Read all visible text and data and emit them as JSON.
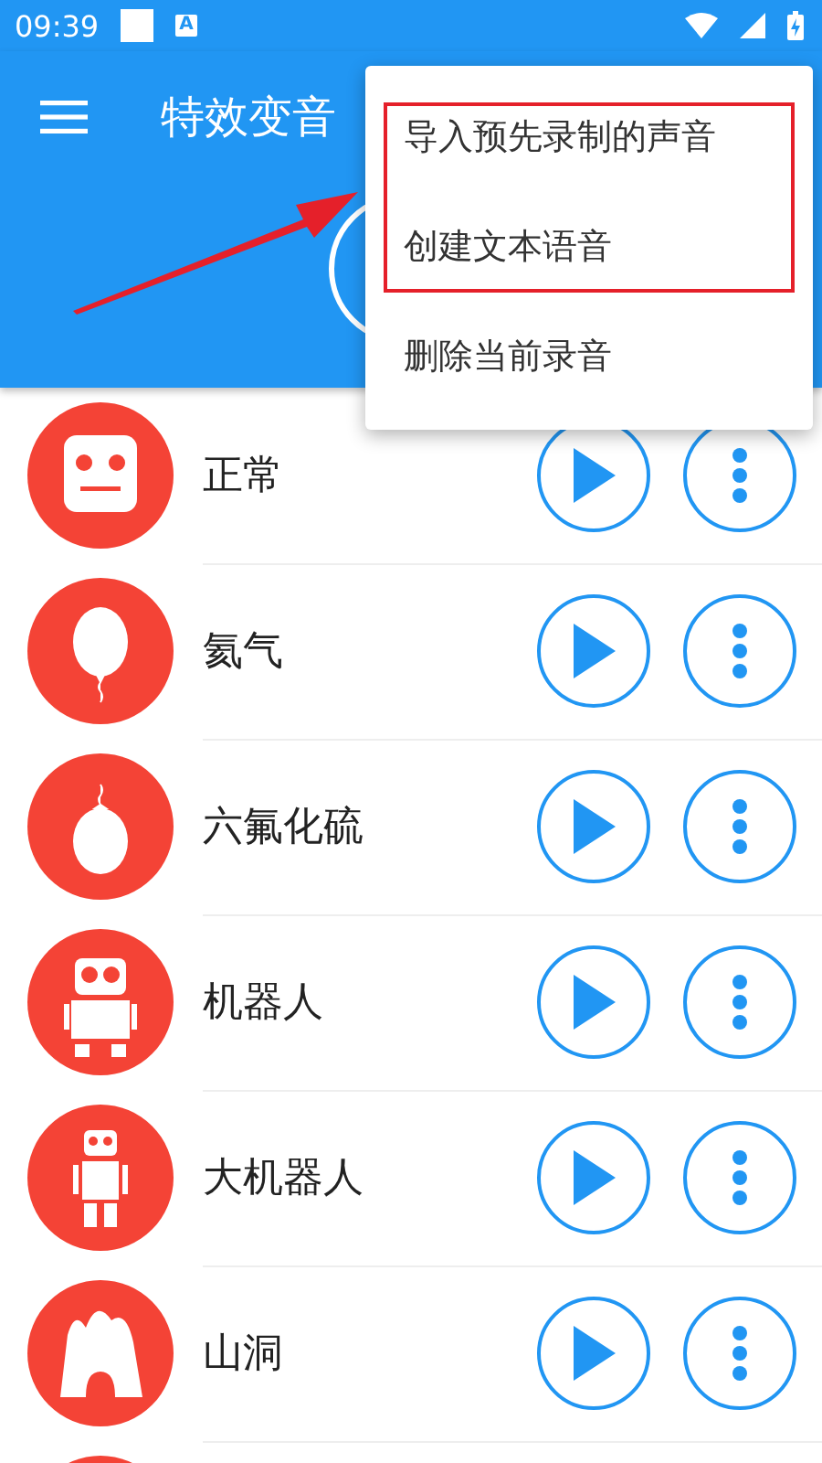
{
  "status_bar": {
    "time": "09:39",
    "notification_glyph": "A"
  },
  "app_bar": {
    "title": "特效变音"
  },
  "menu": {
    "items": [
      {
        "label": "导入预先录制的声音",
        "highlighted": true
      },
      {
        "label": "创建文本语音",
        "highlighted": true
      },
      {
        "label": "删除当前录音",
        "highlighted": false
      }
    ]
  },
  "effects": [
    {
      "name": "正常"
    },
    {
      "name": "氦气"
    },
    {
      "name": "六氟化硫"
    },
    {
      "name": "机器人"
    },
    {
      "name": "大机器人"
    },
    {
      "name": "山洞"
    }
  ]
}
